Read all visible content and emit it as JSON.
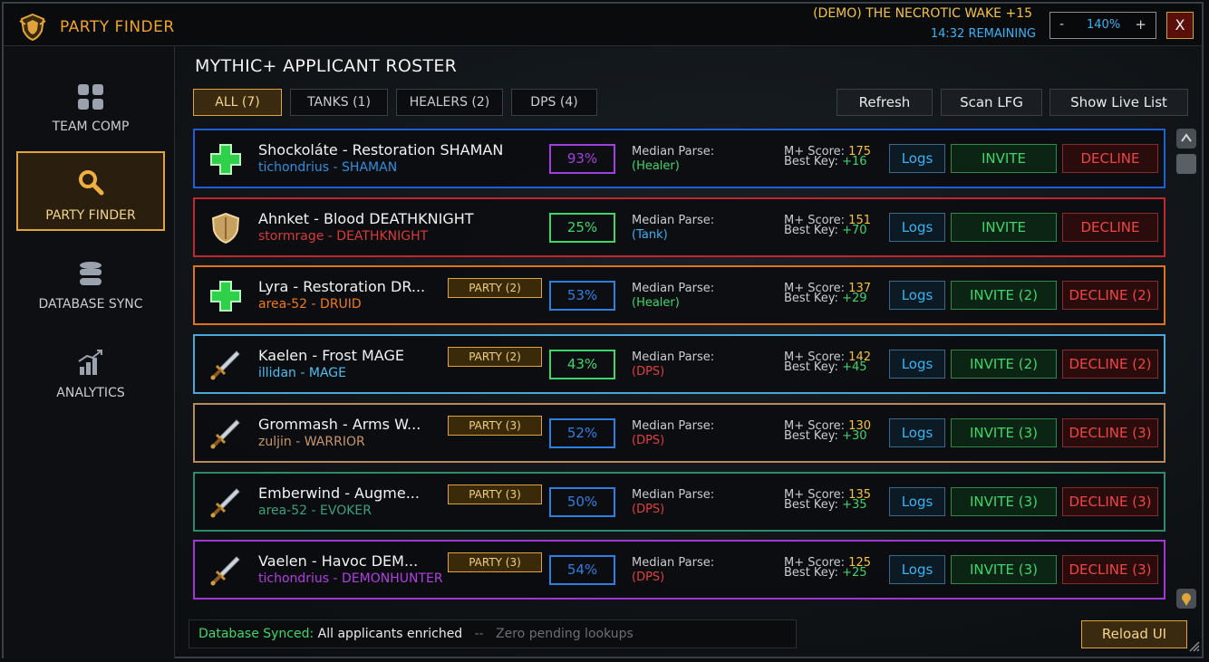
{
  "window": {
    "title": "PARTY FINDER",
    "dungeon": "(DEMO) THE NECROTIC WAKE +15",
    "timer": "14:32 REMAINING",
    "zoom": {
      "minus": "-",
      "value": "140%",
      "plus": "+"
    },
    "close": "X"
  },
  "sidebar": {
    "items": [
      {
        "label": "TEAM COMP",
        "icon": "grid-icon",
        "active": false
      },
      {
        "label": "PARTY FINDER",
        "icon": "search-icon",
        "active": true
      },
      {
        "label": "DATABASE SYNC",
        "icon": "database-icon",
        "active": false
      },
      {
        "label": "ANALYTICS",
        "icon": "bar-chart-icon",
        "active": false
      }
    ]
  },
  "main": {
    "title": "MYTHIC+ APPLICANT ROSTER",
    "tabs": [
      {
        "label": "ALL (7)",
        "active": true
      },
      {
        "label": "TANKS (1)",
        "active": false
      },
      {
        "label": "HEALERS (2)",
        "active": false
      },
      {
        "label": "DPS (4)",
        "active": false
      }
    ],
    "actions": {
      "refresh": "Refresh",
      "scan": "Scan LFG",
      "live": "Show Live List"
    },
    "median_label": "Median Parse:",
    "score_label": "M+ Score:",
    "key_label": "Best Key:",
    "logs_label": "Logs"
  },
  "applicants": [
    {
      "name": "Shockoláte - Restoration SHAMAN",
      "realm": "tichondrius",
      "class": "SHAMAN",
      "role": "(Healer)",
      "role_icon": "healer-cross-icon",
      "party": "",
      "parse": "93%",
      "score": "175",
      "best_key": "+16",
      "invite": "INVITE",
      "decline": "DECLINE",
      "border_color": "#1f5fd6",
      "class_color": "#2f8fe0",
      "parse_color": "#a040e0",
      "role_color": "#3ed66b"
    },
    {
      "name": "Ahnket - Blood DEATHKNIGHT",
      "realm": "stormrage",
      "class": "DEATHKNIGHT",
      "role": "(Tank)",
      "role_icon": "shield-icon",
      "party": "",
      "parse": "25%",
      "score": "151",
      "best_key": "+70",
      "invite": "INVITE",
      "decline": "DECLINE",
      "border_color": "#c0282d",
      "class_color": "#d83a3a",
      "parse_color": "#3ed66b",
      "role_color": "#39b3f5"
    },
    {
      "name": "Lyra - Restoration DR...",
      "realm": "area-52",
      "class": "DRUID",
      "role": "(Healer)",
      "role_icon": "healer-cross-icon",
      "party": "PARTY (2)",
      "parse": "53%",
      "score": "137",
      "best_key": "+29",
      "invite": "INVITE (2)",
      "decline": "DECLINE (2)",
      "border_color": "#e0731a",
      "class_color": "#f07a1a",
      "parse_color": "#2f7fe0",
      "role_color": "#3ed66b"
    },
    {
      "name": "Kaelen - Frost MAGE",
      "realm": "illidan",
      "class": "MAGE",
      "role": "(DPS)",
      "role_icon": "sword-icon",
      "party": "PARTY (2)",
      "parse": "43%",
      "score": "142",
      "best_key": "+45",
      "invite": "INVITE (2)",
      "decline": "DECLINE (2)",
      "border_color": "#4aa8d8",
      "class_color": "#4ac0f0",
      "parse_color": "#3ed66b",
      "role_color": "#e04040"
    },
    {
      "name": "Grommash - Arms W...",
      "realm": "zuljin",
      "class": "WARRIOR",
      "role": "(DPS)",
      "role_icon": "sword-icon",
      "party": "PARTY (3)",
      "parse": "52%",
      "score": "130",
      "best_key": "+30",
      "invite": "INVITE (3)",
      "decline": "DECLINE (3)",
      "border_color": "#b8895a",
      "class_color": "#c8956a",
      "parse_color": "#2f7fe0",
      "role_color": "#e04040"
    },
    {
      "name": "Emberwind - Augme...",
      "realm": "area-52",
      "class": "EVOKER",
      "role": "(DPS)",
      "role_icon": "sword-icon",
      "party": "PARTY (3)",
      "parse": "50%",
      "score": "135",
      "best_key": "+35",
      "invite": "INVITE (3)",
      "decline": "DECLINE (3)",
      "border_color": "#2f8a6a",
      "class_color": "#3aa07a",
      "parse_color": "#2f7fe0",
      "role_color": "#e04040"
    },
    {
      "name": "Vaelen - Havoc DEM...",
      "realm": "tichondrius",
      "class": "DEMONHUNTER",
      "role": "(DPS)",
      "role_icon": "sword-icon",
      "party": "PARTY (3)",
      "parse": "54%",
      "score": "125",
      "best_key": "+25",
      "invite": "INVITE (3)",
      "decline": "DECLINE (3)",
      "border_color": "#a335d6",
      "class_color": "#b040e0",
      "parse_color": "#2f7fe0",
      "role_color": "#e04040"
    }
  ],
  "status": {
    "synced": "Database Synced:",
    "message": "All applicants enriched",
    "sep": "--",
    "pending": "Zero pending lookups"
  },
  "reload": "Reload UI"
}
